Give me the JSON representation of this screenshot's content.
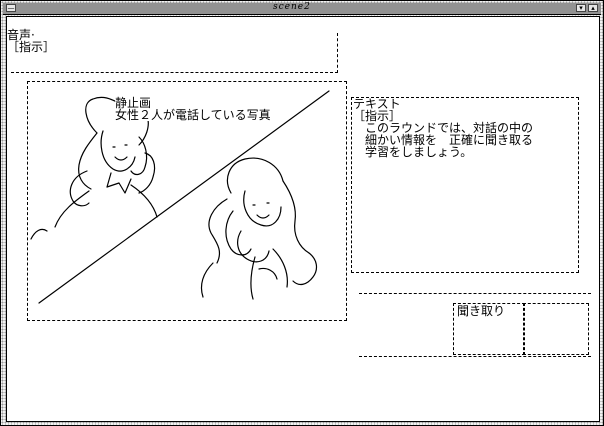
{
  "window": {
    "title": "scene2",
    "menu_glyph": "—",
    "min_glyph": "▾",
    "max_glyph": "▴"
  },
  "audio_panel": {
    "label": "音声·",
    "instruction": "［指示］"
  },
  "image_panel": {
    "label": "静止画",
    "caption": "女性２人が電話している写真"
  },
  "text_panel": {
    "label": "テキスト",
    "instruction": "［指示］",
    "line1": "　このラウンドでは、対話の中の",
    "line2": "細かい情報を　正確に聞き取る",
    "line3": "学習をしましょう。"
  },
  "dictation_panel": {
    "label": "聞き取り"
  }
}
